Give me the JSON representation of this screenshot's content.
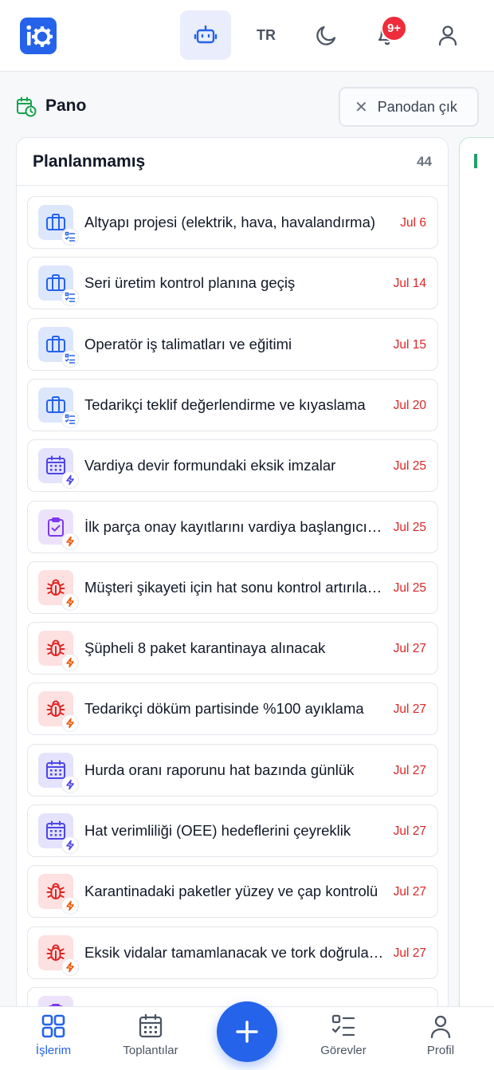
{
  "topbar": {
    "language": "TR",
    "notification_badge": "9+"
  },
  "board": {
    "title": "Pano",
    "exit_label": "Panodan çık"
  },
  "column": {
    "title": "Planlanmamış",
    "count": "44",
    "cards": [
      {
        "title": "Altyapı projesi (elektrik, hava, havalandırma)",
        "date": "Jul 6",
        "icon": "briefcase-icon",
        "sub_icon": "checklist-icon",
        "tone": "blue"
      },
      {
        "title": "Seri üretim kontrol planına geçiş",
        "date": "Jul 14",
        "icon": "briefcase-icon",
        "sub_icon": "checklist-icon",
        "tone": "blue"
      },
      {
        "title": "Operatör iş talimatları ve eğitimi",
        "date": "Jul 15",
        "icon": "briefcase-icon",
        "sub_icon": "checklist-icon",
        "tone": "blue"
      },
      {
        "title": "Tedarikçi teklif değerlendirme ve kıyaslama",
        "date": "Jul 20",
        "icon": "briefcase-icon",
        "sub_icon": "checklist-icon",
        "tone": "blue"
      },
      {
        "title": "Vardiya devir formundaki eksik imzalar",
        "date": "Jul 25",
        "icon": "calendar-icon",
        "sub_icon": "bolt-icon",
        "tone": "indigo"
      },
      {
        "title": "İlk parça onay kayıtlarını vardiya başlangıcında",
        "date": "Jul 25",
        "icon": "clipboard-check-icon",
        "sub_icon": "bolt-icon",
        "tone": "purple"
      },
      {
        "title": "Müşteri şikayeti için hat sonu kontrol artırılacak",
        "date": "Jul 25",
        "icon": "bug-icon",
        "sub_icon": "bolt-icon",
        "tone": "red"
      },
      {
        "title": "Şüpheli 8 paket karantinaya alınacak",
        "date": "Jul 27",
        "icon": "bug-icon",
        "sub_icon": "bolt-icon",
        "tone": "red"
      },
      {
        "title": "Tedarikçi döküm partisinde %100 ayıklama",
        "date": "Jul 27",
        "icon": "bug-icon",
        "sub_icon": "bolt-icon",
        "tone": "red"
      },
      {
        "title": "Hurda oranı raporunu hat bazında günlük",
        "date": "Jul 27",
        "icon": "calendar-icon",
        "sub_icon": "bolt-icon",
        "tone": "indigo"
      },
      {
        "title": "Hat verimliliği (OEE) hedeflerini çeyreklik",
        "date": "Jul 27",
        "icon": "calendar-icon",
        "sub_icon": "bolt-icon",
        "tone": "indigo"
      },
      {
        "title": "Karantinadaki paketler yüzey ve çap kontrolü",
        "date": "Jul 27",
        "icon": "bug-icon",
        "sub_icon": "bolt-icon",
        "tone": "red"
      },
      {
        "title": "Eksik vidalar tamamlanacak ve tork doğrulanacak",
        "date": "Jul 27",
        "icon": "bug-icon",
        "sub_icon": "bolt-icon",
        "tone": "red"
      }
    ]
  },
  "bottomnav": {
    "items": [
      {
        "label": "İşlerim",
        "icon": "grid-icon",
        "active": true
      },
      {
        "label": "Toplantılar",
        "icon": "calendar-icon",
        "active": false
      },
      {
        "label": "Görevler",
        "icon": "checklist-icon",
        "active": false
      },
      {
        "label": "Profil",
        "icon": "user-icon",
        "active": false
      }
    ]
  },
  "colors": {
    "accent": "#2563eb",
    "due_date": "#dc2626",
    "board_icon": "#16a34a"
  }
}
